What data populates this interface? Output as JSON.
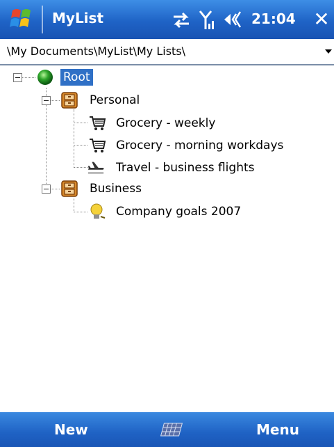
{
  "titlebar": {
    "app_title": "MyList",
    "clock": "21:04",
    "close_glyph": "✕",
    "icons": [
      "windows-start-icon",
      "sync-icon",
      "signal-icon",
      "volume-icon"
    ]
  },
  "path": {
    "value": "\\My Documents\\MyList\\My Lists\\"
  },
  "tree": {
    "root": {
      "label": "Root",
      "icon": "green-orb-icon",
      "selected": true
    },
    "groups": [
      {
        "label": "Personal",
        "icon": "cabinet-icon",
        "items": [
          {
            "label": "Grocery - weekly",
            "icon": "shopping-cart-icon"
          },
          {
            "label": "Grocery - morning workdays",
            "icon": "shopping-cart-icon"
          },
          {
            "label": "Travel - business flights",
            "icon": "airplane-icon"
          }
        ]
      },
      {
        "label": "Business",
        "icon": "cabinet-icon",
        "items": [
          {
            "label": "Company goals 2007",
            "icon": "lightbulb-icon"
          }
        ]
      }
    ]
  },
  "softkeys": {
    "left": "New",
    "right": "Menu",
    "center_icon": "keyboard-icon"
  },
  "colors": {
    "titlebar": "#1f63c6",
    "selection": "#2f70c6"
  }
}
